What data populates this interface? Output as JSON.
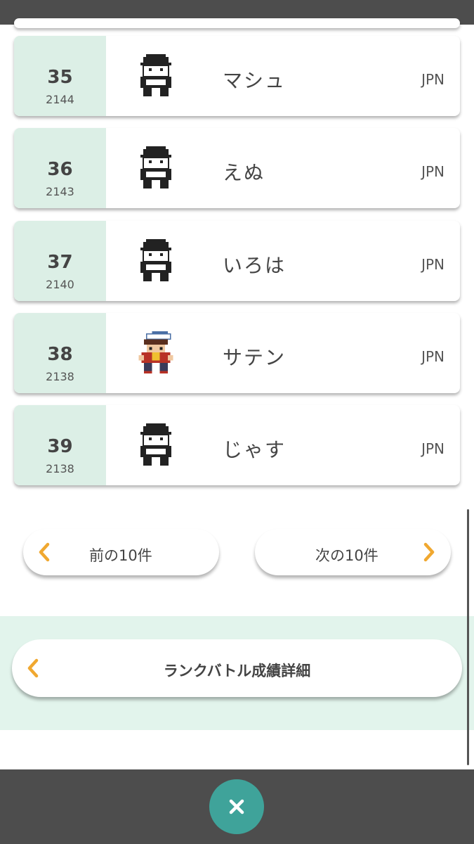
{
  "ranking": {
    "rows": [
      {
        "rank": "35",
        "rating": "2144",
        "name": "マシュ",
        "country": "JPN",
        "avatar": "trainer-mono-icon"
      },
      {
        "rank": "36",
        "rating": "2143",
        "name": "えぬ",
        "country": "JPN",
        "avatar": "trainer-mono-icon"
      },
      {
        "rank": "37",
        "rating": "2140",
        "name": "いろは",
        "country": "JPN",
        "avatar": "trainer-mono-icon"
      },
      {
        "rank": "38",
        "rating": "2138",
        "name": "サテン",
        "country": "JPN",
        "avatar": "trainer-color-icon"
      },
      {
        "rank": "39",
        "rating": "2138",
        "name": "じゃす",
        "country": "JPN",
        "avatar": "trainer-mono-icon"
      }
    ]
  },
  "pagination": {
    "prev_label": "前の10件",
    "next_label": "次の10件"
  },
  "detail": {
    "label": "ランクバトル成績詳細"
  },
  "colors": {
    "rank_cell_bg": "#dcefe6",
    "accent_arrow": "#f0a830",
    "close_button": "#3fa39a",
    "bars": "#4d4d4d"
  },
  "icons": {
    "arrow_left": "chevron-left-icon",
    "arrow_right": "chevron-right-icon",
    "close": "close-icon"
  }
}
